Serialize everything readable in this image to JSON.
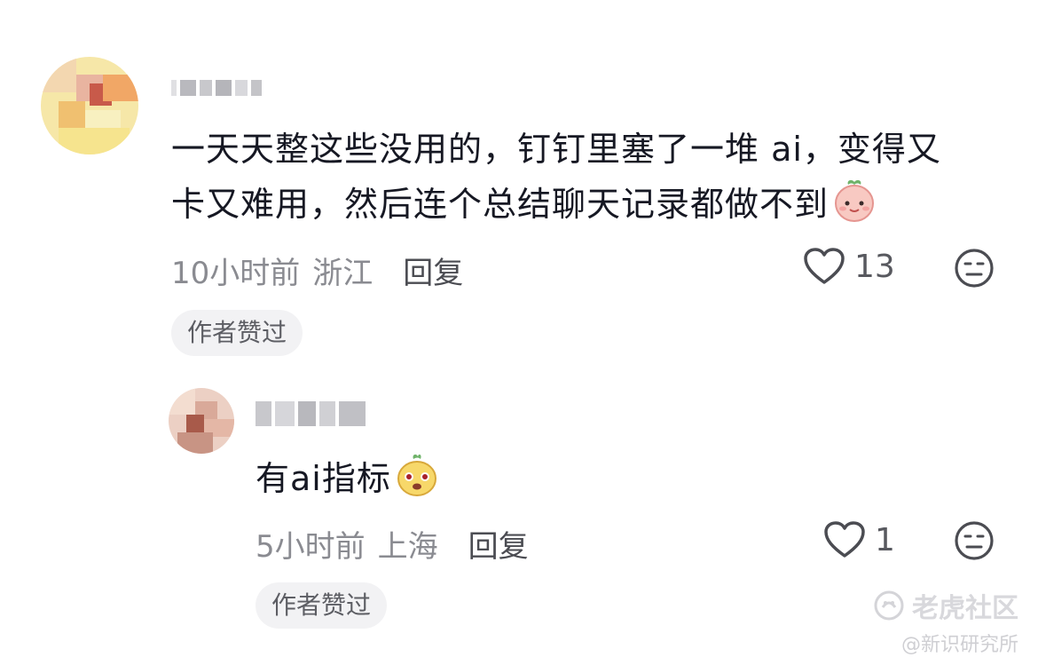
{
  "comments": [
    {
      "text": "一天天整这些没用的，钉钉里塞了一堆ai，变得又卡又难用，然后连个总结聊天记录都做不到",
      "line1": "一天天整这些没用的，钉钉里塞了一堆 ai，变得又",
      "line2": "卡又难用，然后连个总结聊天记录都做不到",
      "time": "10小时前",
      "location": "浙江",
      "reply_label": "回复",
      "likes": "13",
      "author_badge": "作者赞过",
      "emoji_icon": "peach-face-emoji"
    },
    {
      "text": "有ai指标",
      "time": "5小时前",
      "location": "上海",
      "reply_label": "回复",
      "likes": "1",
      "author_badge": "作者赞过",
      "emoji_icon": "yellow-face-emoji"
    }
  ],
  "watermark": {
    "brand": "老虎社区",
    "handle": "@新识研究所"
  }
}
